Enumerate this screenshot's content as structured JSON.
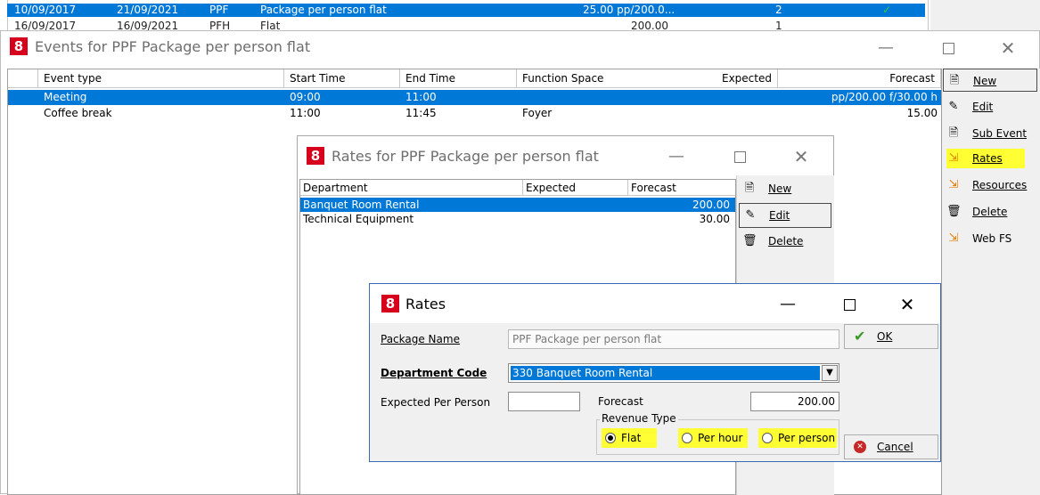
{
  "bg_list": {
    "row1": {
      "start": "10/09/2017",
      "end": "21/09/2021",
      "code": "PPF",
      "name": "Package per person flat",
      "rate": "25.00 pp/200.0...",
      "count": "2"
    },
    "row2": {
      "start": "16/09/2017",
      "end": "16/09/2021",
      "code": "PFH",
      "name": "Flat",
      "rate": "200.00",
      "count": "1"
    }
  },
  "events_window": {
    "title": "Events for PPF Package per person flat",
    "columns": [
      "Event type",
      "Start Time",
      "End Time",
      "Function Space",
      "Expected",
      "Forecast"
    ],
    "rows": [
      {
        "event_type": "Meeting",
        "start": "09:00",
        "end": "11:00",
        "space": "",
        "expected": "",
        "forecast": "pp/200.00 f/30.00 h"
      },
      {
        "event_type": "Coffee break",
        "start": "11:00",
        "end": "11:45",
        "space": "Foyer",
        "expected": "",
        "forecast": "15.00"
      }
    ],
    "buttons": {
      "new": "New",
      "edit": "Edit",
      "sub_event": "Sub Event",
      "rates": "Rates",
      "resources": "Resources",
      "delete": "Delete",
      "web_fs": "Web FS"
    }
  },
  "rates_list_window": {
    "title": "Rates for PPF Package per person flat",
    "columns": [
      "Department",
      "Expected",
      "Forecast"
    ],
    "rows": [
      {
        "department": "Banquet Room Rental",
        "expected": "",
        "forecast": "200.00"
      },
      {
        "department": "Technical Equipment",
        "expected": "",
        "forecast": "30.00"
      }
    ],
    "buttons": {
      "new": "New",
      "edit": "Edit",
      "delete": "Delete"
    }
  },
  "rates_dialog": {
    "title": "Rates",
    "package_name_label": "Package Name",
    "package_name_value": "PPF Package per person flat",
    "department_code_label": "Department Code",
    "department_code_value": "330  Banquet Room Rental",
    "expected_pp_label": "Expected Per Person",
    "expected_pp_value": "",
    "forecast_label": "Forecast",
    "forecast_value": "200.00",
    "revenue_type_label": "Revenue Type",
    "revenue_types": [
      "Flat",
      "Per hour",
      "Per person"
    ],
    "revenue_type_selected": "Flat",
    "ok_label": "OK",
    "cancel_label": "Cancel"
  },
  "colors": {
    "selection": "#0078d7",
    "highlight": "#ffff33",
    "logo": "#d6001c"
  }
}
